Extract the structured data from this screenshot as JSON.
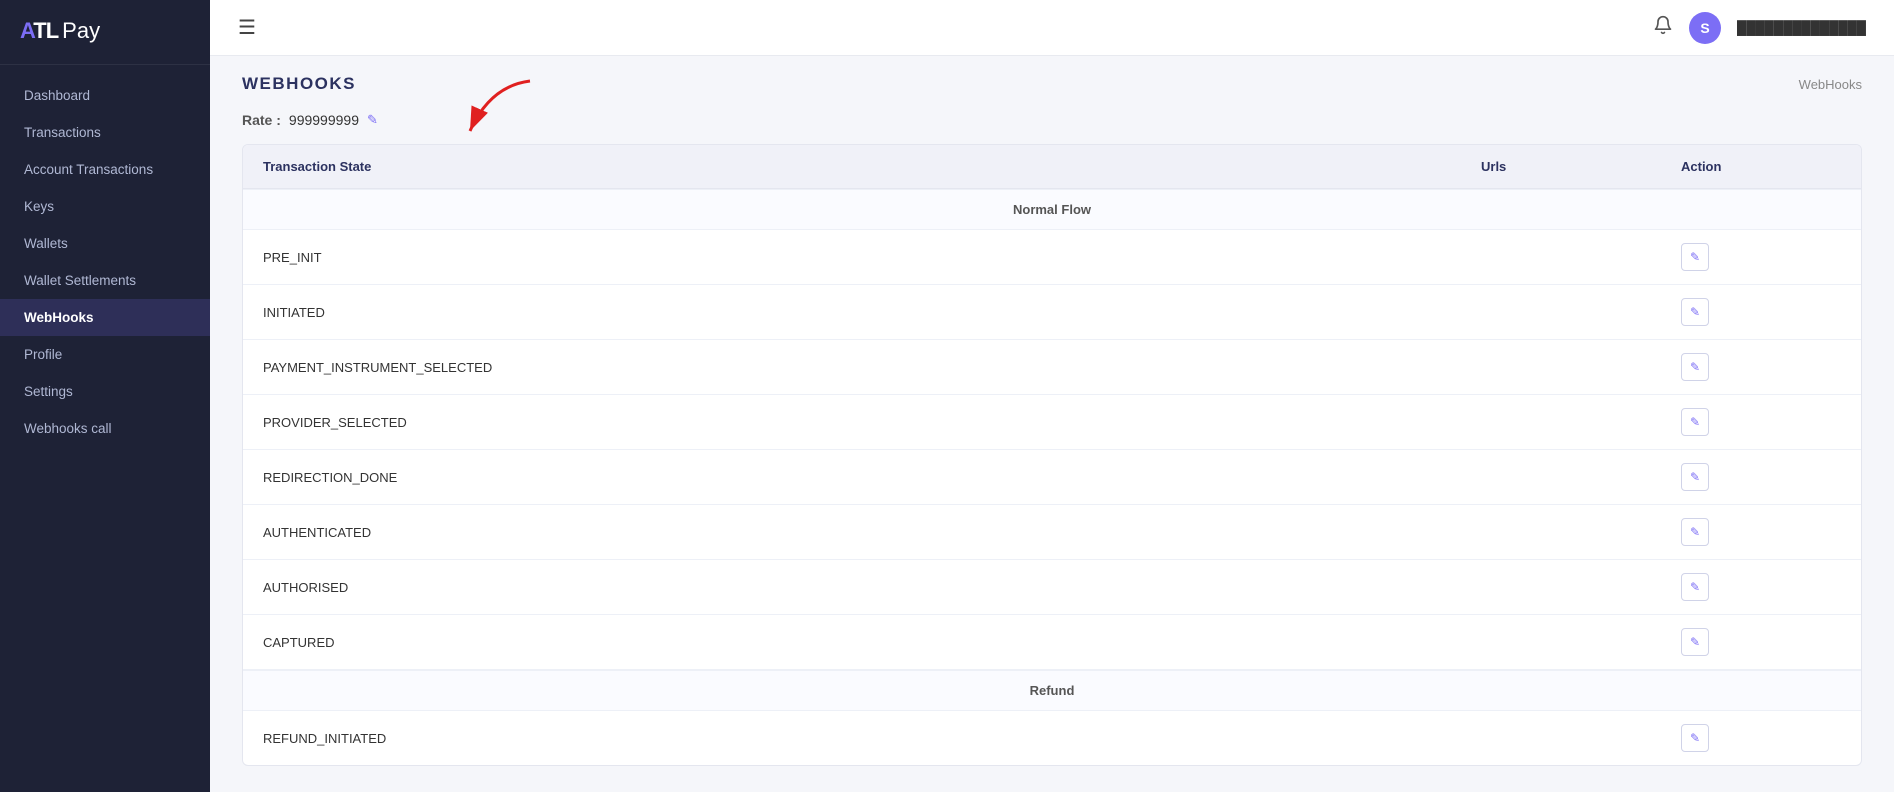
{
  "logo": {
    "atl": "ATL",
    "pay": "Pay"
  },
  "sidebar": {
    "items": [
      {
        "id": "dashboard",
        "label": "Dashboard",
        "active": false
      },
      {
        "id": "transactions",
        "label": "Transactions",
        "active": false
      },
      {
        "id": "account-transactions",
        "label": "Account Transactions",
        "active": false
      },
      {
        "id": "keys",
        "label": "Keys",
        "active": false
      },
      {
        "id": "wallets",
        "label": "Wallets",
        "active": false
      },
      {
        "id": "wallet-settlements",
        "label": "Wallet Settlements",
        "active": false
      },
      {
        "id": "webhooks",
        "label": "WebHooks",
        "active": true
      },
      {
        "id": "profile",
        "label": "Profile",
        "active": false
      },
      {
        "id": "settings",
        "label": "Settings",
        "active": false
      },
      {
        "id": "webhooks-call",
        "label": "Webhooks call",
        "active": false
      }
    ]
  },
  "topbar": {
    "hamburger": "☰",
    "bell": "🔔",
    "user_initial": "S",
    "user_name": "██████████████"
  },
  "page": {
    "title": "WEBHOOKS",
    "breadcrumb": "WebHooks"
  },
  "rate": {
    "label": "Rate :",
    "value": "999999999",
    "edit_icon": "✎"
  },
  "table": {
    "columns": [
      {
        "id": "transaction-state",
        "label": "Transaction State"
      },
      {
        "id": "urls",
        "label": "Urls"
      },
      {
        "id": "action",
        "label": "Action"
      }
    ],
    "sections": [
      {
        "label": "Normal Flow",
        "rows": [
          {
            "state": "PRE_INIT",
            "url": "",
            "has_action": true
          },
          {
            "state": "INITIATED",
            "url": "",
            "has_action": true
          },
          {
            "state": "PAYMENT_INSTRUMENT_SELECTED",
            "url": "",
            "has_action": true
          },
          {
            "state": "PROVIDER_SELECTED",
            "url": "",
            "has_action": true
          },
          {
            "state": "REDIRECTION_DONE",
            "url": "",
            "has_action": true
          },
          {
            "state": "AUTHENTICATED",
            "url": "",
            "has_action": true
          },
          {
            "state": "AUTHORISED",
            "url": "",
            "has_action": true
          },
          {
            "state": "CAPTURED",
            "url": "",
            "has_action": true
          }
        ]
      },
      {
        "label": "Refund",
        "rows": [
          {
            "state": "REFUND_INITIATED",
            "url": "",
            "has_action": true
          }
        ]
      }
    ],
    "edit_icon": "✎"
  }
}
